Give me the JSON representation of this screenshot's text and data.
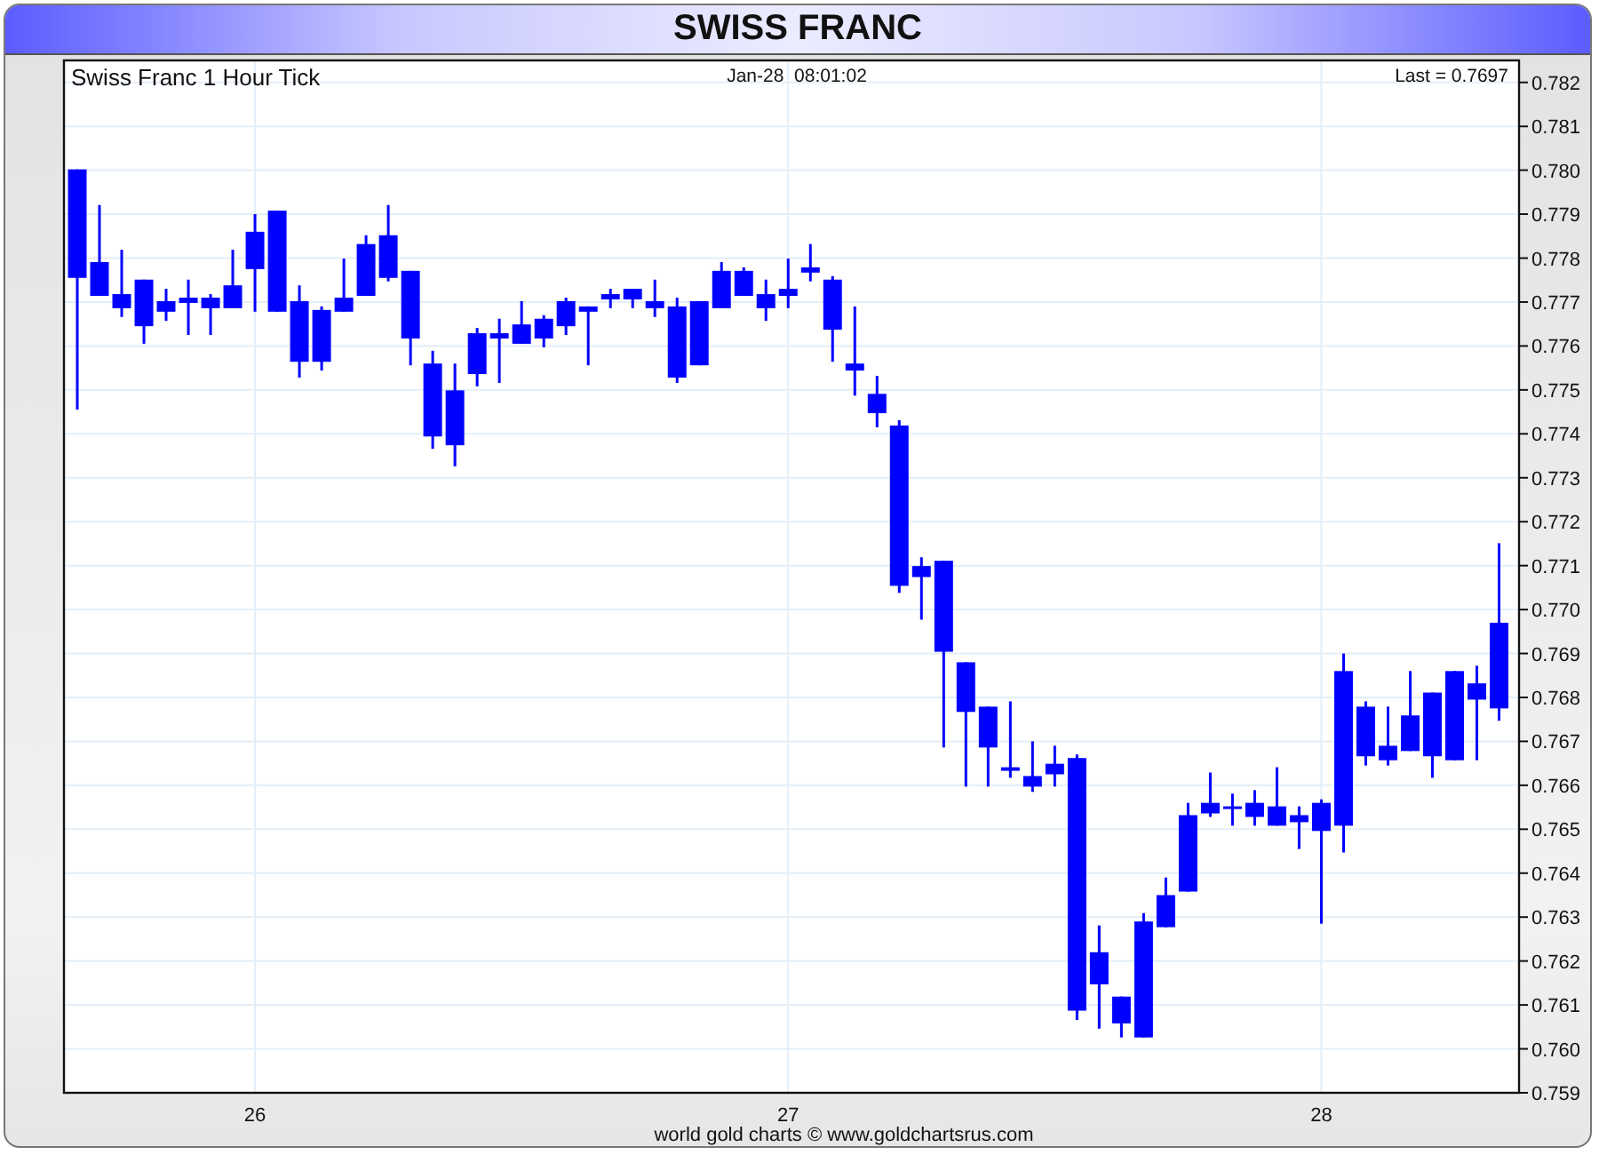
{
  "title": "SWISS FRANC",
  "chart": {
    "timestamp": "Jan-28  08:01:02",
    "last_price": "Last = 0.7697",
    "chart_data": {
      "type": "candlestick",
      "title": "Swiss Franc 1 Hour Tick",
      "x": [
        25.6667,
        25.7083,
        25.75,
        25.7917,
        25.8333,
        25.875,
        25.9167,
        25.9583,
        26,
        26.0417,
        26.0833,
        26.125,
        26.1667,
        26.2083,
        26.25,
        26.2917,
        26.3333,
        26.375,
        26.4167,
        26.4583,
        26.5,
        26.5417,
        26.5833,
        26.625,
        26.6667,
        26.7083,
        26.75,
        26.7917,
        26.8333,
        26.875,
        26.9167,
        26.9583,
        27,
        27.0417,
        27.0833,
        27.125,
        27.1667,
        27.2083,
        27.25,
        27.2917,
        27.3333,
        27.375,
        27.4167,
        27.4583,
        27.5,
        27.5417,
        27.5833,
        27.625,
        27.6667,
        27.7083,
        27.75,
        27.7917,
        27.8333,
        27.875,
        27.9167,
        27.9583,
        28,
        28.0417,
        28.0833,
        28.125,
        28.1667,
        28.2083,
        28.25,
        28.2917,
        28.3333
      ],
      "ohlc": [
        [
          0.77755,
          0.78002,
          0.77455,
          0.78002
        ],
        [
          0.77714,
          0.77921,
          0.77714,
          0.77791
        ],
        [
          0.77686,
          0.77819,
          0.77666,
          0.77718
        ],
        [
          0.77645,
          0.77751,
          0.77605,
          0.77751
        ],
        [
          0.77678,
          0.7773,
          0.77657,
          0.77702
        ],
        [
          0.77698,
          0.77751,
          0.77625,
          0.7771
        ],
        [
          0.77686,
          0.77718,
          0.77625,
          0.7771
        ],
        [
          0.77686,
          0.77819,
          0.77686,
          0.77738
        ],
        [
          0.77775,
          0.779,
          0.77678,
          0.7786
        ],
        [
          0.77678,
          0.77908,
          0.77678,
          0.77908
        ],
        [
          0.77564,
          0.77738,
          0.77528,
          0.77702
        ],
        [
          0.77564,
          0.7769,
          0.77544,
          0.77682
        ],
        [
          0.77678,
          0.77799,
          0.77678,
          0.7771
        ],
        [
          0.77714,
          0.77852,
          0.77714,
          0.77832
        ],
        [
          0.77755,
          0.77921,
          0.77747,
          0.77852
        ],
        [
          0.77617,
          0.77771,
          0.77556,
          0.77771
        ],
        [
          0.77394,
          0.77589,
          0.77366,
          0.7756
        ],
        [
          0.77374,
          0.7756,
          0.77326,
          0.77499
        ],
        [
          0.77536,
          0.77641,
          0.77508,
          0.77629
        ],
        [
          0.77617,
          0.77662,
          0.77516,
          0.77629
        ],
        [
          0.77605,
          0.77702,
          0.77605,
          0.77649
        ],
        [
          0.77617,
          0.7767,
          0.77597,
          0.77662
        ],
        [
          0.77645,
          0.7771,
          0.77625,
          0.77702
        ],
        [
          0.77678,
          0.7769,
          0.77556,
          0.7769
        ],
        [
          0.77706,
          0.7773,
          0.77686,
          0.77718
        ],
        [
          0.77706,
          0.7773,
          0.77686,
          0.7773
        ],
        [
          0.77686,
          0.77751,
          0.77666,
          0.77702
        ],
        [
          0.77528,
          0.7771,
          0.77516,
          0.7769
        ],
        [
          0.77556,
          0.77702,
          0.77556,
          0.77702
        ],
        [
          0.77686,
          0.77791,
          0.77686,
          0.77771
        ],
        [
          0.77714,
          0.77779,
          0.77714,
          0.77771
        ],
        [
          0.77686,
          0.77751,
          0.77657,
          0.77718
        ],
        [
          0.77714,
          0.77799,
          0.77686,
          0.7773
        ],
        [
          0.77767,
          0.77832,
          0.77747,
          0.77779
        ],
        [
          0.77637,
          0.77759,
          0.77564,
          0.77751
        ],
        [
          0.77544,
          0.7769,
          0.77487,
          0.7756
        ],
        [
          0.77447,
          0.77532,
          0.77415,
          0.77491
        ],
        [
          0.77054,
          0.77431,
          0.77038,
          0.77419
        ],
        [
          0.77074,
          0.77119,
          0.76977,
          0.77099
        ],
        [
          0.76904,
          0.77111,
          0.76686,
          0.77111
        ],
        [
          0.76767,
          0.7688,
          0.76597,
          0.7688
        ],
        [
          0.76686,
          0.76779,
          0.76597,
          0.76779
        ],
        [
          0.76633,
          0.76791,
          0.76617,
          0.76641
        ],
        [
          0.76597,
          0.767,
          0.76585,
          0.76621
        ],
        [
          0.76625,
          0.7669,
          0.76597,
          0.76649
        ],
        [
          0.76087,
          0.7667,
          0.76066,
          0.76662
        ],
        [
          0.76147,
          0.76281,
          0.76046,
          0.7622
        ],
        [
          0.76058,
          0.76119,
          0.76026,
          0.76119
        ],
        [
          0.76026,
          0.76309,
          0.76026,
          0.7629
        ],
        [
          0.76277,
          0.7639,
          0.76277,
          0.7635
        ],
        [
          0.76358,
          0.7656,
          0.76358,
          0.76532
        ],
        [
          0.76536,
          0.76629,
          0.76528,
          0.7656
        ],
        [
          0.76548,
          0.76581,
          0.76508,
          0.76552
        ],
        [
          0.76528,
          0.76589,
          0.76508,
          0.7656
        ],
        [
          0.76508,
          0.76641,
          0.76508,
          0.76552
        ],
        [
          0.76516,
          0.76552,
          0.76455,
          0.76532
        ],
        [
          0.76496,
          0.76568,
          0.76285,
          0.7656
        ],
        [
          0.76508,
          0.769,
          0.76447,
          0.7686
        ],
        [
          0.76666,
          0.76791,
          0.76645,
          0.76779
        ],
        [
          0.76657,
          0.76779,
          0.76645,
          0.7669
        ],
        [
          0.76678,
          0.7686,
          0.76678,
          0.76759
        ],
        [
          0.76666,
          0.76811,
          0.76617,
          0.76811
        ],
        [
          0.76657,
          0.7686,
          0.76657,
          0.7686
        ],
        [
          0.76795,
          0.76872,
          0.76657,
          0.76832
        ],
        [
          0.76775,
          0.77151,
          0.76747,
          0.7697
        ]
      ],
      "xlim": [
        25.6417,
        28.3708
      ],
      "ylim": [
        0.759,
        0.7825
      ],
      "xticks": [
        26,
        27,
        28
      ],
      "yticks": [
        {
          "value": 0.759,
          "label": "0.759"
        },
        {
          "value": 0.76,
          "label": "0.760"
        },
        {
          "value": 0.761,
          "label": "0.761"
        },
        {
          "value": 0.762,
          "label": "0.762"
        },
        {
          "value": 0.763,
          "label": "0.763"
        },
        {
          "value": 0.764,
          "label": "0.764"
        },
        {
          "value": 0.765,
          "label": "0.765"
        },
        {
          "value": 0.766,
          "label": "0.766"
        },
        {
          "value": 0.767,
          "label": "0.767"
        },
        {
          "value": 0.768,
          "label": "0.768"
        },
        {
          "value": 0.769,
          "label": "0.769"
        },
        {
          "value": 0.77,
          "label": "0.770"
        },
        {
          "value": 0.771,
          "label": "0.771"
        },
        {
          "value": 0.772,
          "label": "0.772"
        },
        {
          "value": 0.773,
          "label": "0.773"
        },
        {
          "value": 0.774,
          "label": "0.774"
        },
        {
          "value": 0.775,
          "label": "0.775"
        },
        {
          "value": 0.776,
          "label": "0.776"
        },
        {
          "value": 0.777,
          "label": "0.777"
        },
        {
          "value": 0.778,
          "label": "0.778"
        },
        {
          "value": 0.779,
          "label": "0.779"
        },
        {
          "value": 0.78,
          "label": "0.780"
        },
        {
          "value": 0.781,
          "label": "0.781"
        },
        {
          "value": 0.782,
          "label": "0.782"
        }
      ],
      "grid": true
    }
  },
  "footer": "world gold charts © www.goldchartsrus.com"
}
